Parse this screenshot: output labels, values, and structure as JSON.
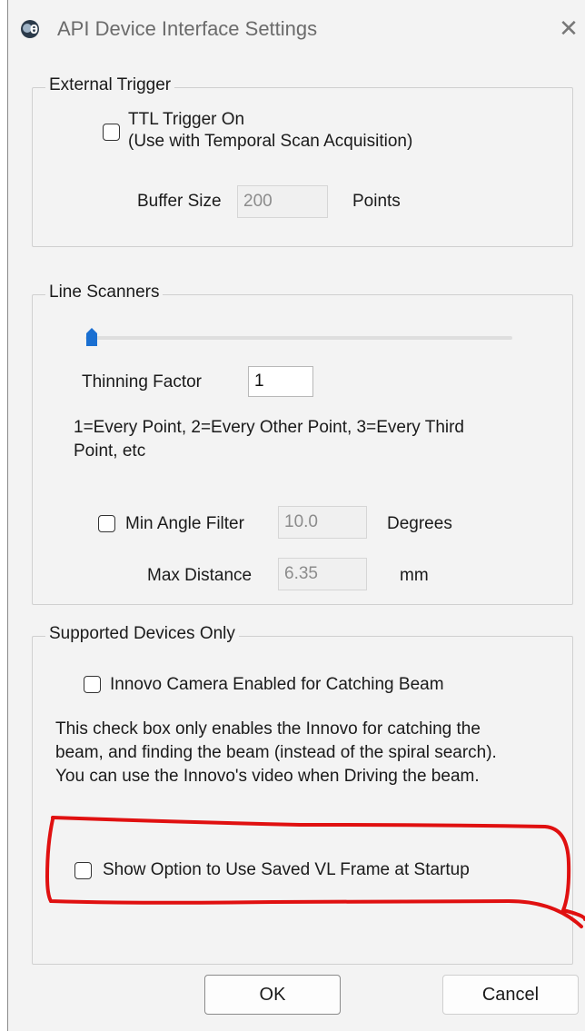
{
  "window": {
    "title": "API Device Interface Settings",
    "close_glyph": "✕",
    "icon": "app-logo-icon"
  },
  "external_trigger": {
    "legend": "External Trigger",
    "ttl_label_line1": "TTL Trigger On",
    "ttl_label_line2": "(Use with Temporal Scan Acquisition)",
    "ttl_checked": false,
    "buffer_label": "Buffer Size",
    "buffer_value": "200",
    "buffer_unit": "Points"
  },
  "line_scanners": {
    "legend": "Line Scanners",
    "slider_value": 0,
    "thinning_label": "Thinning Factor",
    "thinning_value": "1",
    "help_line1": "1=Every Point, 2=Every Other Point, 3=Every Third",
    "help_line2": "Point, etc",
    "min_angle_label": "Min Angle Filter",
    "min_angle_checked": false,
    "min_angle_value": "10.0",
    "min_angle_unit": "Degrees",
    "max_distance_label": "Max Distance",
    "max_distance_value": "6.35",
    "max_distance_unit": "mm"
  },
  "supported_devices": {
    "legend": "Supported Devices Only",
    "innovo_label": "Innovo Camera Enabled for Catching Beam",
    "innovo_checked": false,
    "desc_line1": "This check box only enables the Innovo for catching the",
    "desc_line2": "beam, and finding the beam (instead of the spiral search).",
    "desc_line3": "You can use the Innovo's video when Driving the beam."
  },
  "saved_frame": {
    "label": "Show Option to Use Saved VL Frame at Startup",
    "checked": false
  },
  "buttons": {
    "ok": "OK",
    "cancel": "Cancel"
  },
  "colors": {
    "annotation": "#e01010",
    "slider_thumb": "#1a6fd1"
  }
}
